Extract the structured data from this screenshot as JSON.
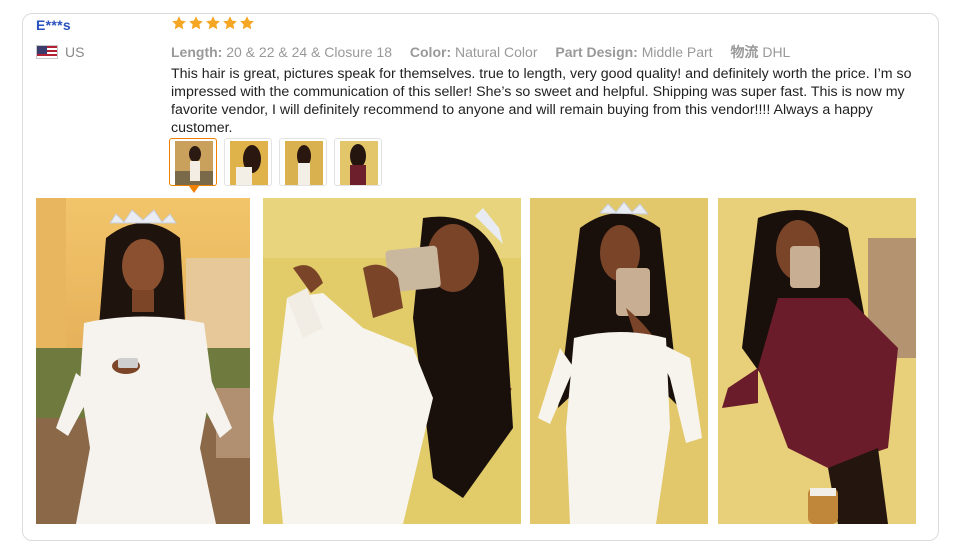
{
  "review": {
    "user_name": "E***s",
    "country_code": "US",
    "flag_icon": "us-flag-icon",
    "rating": 5,
    "star_color": "#f5a623",
    "attributes": [
      {
        "label": "Length:",
        "value": "20 & 22 & 24 & Closure 18"
      },
      {
        "label": "Color:",
        "value": "Natural Color"
      },
      {
        "label": "Part Design:",
        "value": "Middle Part"
      },
      {
        "label": "物流",
        "value": "DHL"
      }
    ],
    "text": "This hair is great, pictures speak for themselves.  true to length, very good quality! and definitely worth the price. I’m so impressed with the communication of this seller! She’s so sweet and helpful. Shipping was super fast. This is now my favorite vendor, I will definitely recommend to anyone and will remain buying from this vendor!!!! Always a happy customer.",
    "thumbnails": 4,
    "selected_thumbnail": 1,
    "photos": 4,
    "accent_color": "#f08000"
  }
}
